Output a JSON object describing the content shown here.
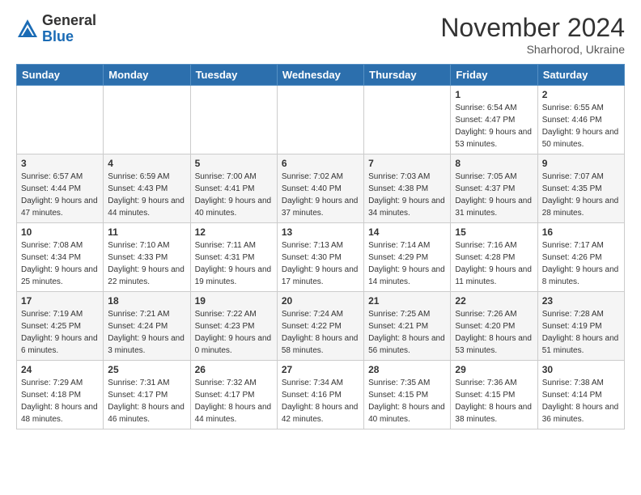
{
  "logo": {
    "general": "General",
    "blue": "Blue"
  },
  "header": {
    "month": "November 2024",
    "location": "Sharhorod, Ukraine"
  },
  "weekdays": [
    "Sunday",
    "Monday",
    "Tuesday",
    "Wednesday",
    "Thursday",
    "Friday",
    "Saturday"
  ],
  "weeks": [
    [
      null,
      null,
      null,
      null,
      null,
      {
        "day": "1",
        "sunrise": "Sunrise: 6:54 AM",
        "sunset": "Sunset: 4:47 PM",
        "daylight": "Daylight: 9 hours and 53 minutes."
      },
      {
        "day": "2",
        "sunrise": "Sunrise: 6:55 AM",
        "sunset": "Sunset: 4:46 PM",
        "daylight": "Daylight: 9 hours and 50 minutes."
      }
    ],
    [
      {
        "day": "3",
        "sunrise": "Sunrise: 6:57 AM",
        "sunset": "Sunset: 4:44 PM",
        "daylight": "Daylight: 9 hours and 47 minutes."
      },
      {
        "day": "4",
        "sunrise": "Sunrise: 6:59 AM",
        "sunset": "Sunset: 4:43 PM",
        "daylight": "Daylight: 9 hours and 44 minutes."
      },
      {
        "day": "5",
        "sunrise": "Sunrise: 7:00 AM",
        "sunset": "Sunset: 4:41 PM",
        "daylight": "Daylight: 9 hours and 40 minutes."
      },
      {
        "day": "6",
        "sunrise": "Sunrise: 7:02 AM",
        "sunset": "Sunset: 4:40 PM",
        "daylight": "Daylight: 9 hours and 37 minutes."
      },
      {
        "day": "7",
        "sunrise": "Sunrise: 7:03 AM",
        "sunset": "Sunset: 4:38 PM",
        "daylight": "Daylight: 9 hours and 34 minutes."
      },
      {
        "day": "8",
        "sunrise": "Sunrise: 7:05 AM",
        "sunset": "Sunset: 4:37 PM",
        "daylight": "Daylight: 9 hours and 31 minutes."
      },
      {
        "day": "9",
        "sunrise": "Sunrise: 7:07 AM",
        "sunset": "Sunset: 4:35 PM",
        "daylight": "Daylight: 9 hours and 28 minutes."
      }
    ],
    [
      {
        "day": "10",
        "sunrise": "Sunrise: 7:08 AM",
        "sunset": "Sunset: 4:34 PM",
        "daylight": "Daylight: 9 hours and 25 minutes."
      },
      {
        "day": "11",
        "sunrise": "Sunrise: 7:10 AM",
        "sunset": "Sunset: 4:33 PM",
        "daylight": "Daylight: 9 hours and 22 minutes."
      },
      {
        "day": "12",
        "sunrise": "Sunrise: 7:11 AM",
        "sunset": "Sunset: 4:31 PM",
        "daylight": "Daylight: 9 hours and 19 minutes."
      },
      {
        "day": "13",
        "sunrise": "Sunrise: 7:13 AM",
        "sunset": "Sunset: 4:30 PM",
        "daylight": "Daylight: 9 hours and 17 minutes."
      },
      {
        "day": "14",
        "sunrise": "Sunrise: 7:14 AM",
        "sunset": "Sunset: 4:29 PM",
        "daylight": "Daylight: 9 hours and 14 minutes."
      },
      {
        "day": "15",
        "sunrise": "Sunrise: 7:16 AM",
        "sunset": "Sunset: 4:28 PM",
        "daylight": "Daylight: 9 hours and 11 minutes."
      },
      {
        "day": "16",
        "sunrise": "Sunrise: 7:17 AM",
        "sunset": "Sunset: 4:26 PM",
        "daylight": "Daylight: 9 hours and 8 minutes."
      }
    ],
    [
      {
        "day": "17",
        "sunrise": "Sunrise: 7:19 AM",
        "sunset": "Sunset: 4:25 PM",
        "daylight": "Daylight: 9 hours and 6 minutes."
      },
      {
        "day": "18",
        "sunrise": "Sunrise: 7:21 AM",
        "sunset": "Sunset: 4:24 PM",
        "daylight": "Daylight: 9 hours and 3 minutes."
      },
      {
        "day": "19",
        "sunrise": "Sunrise: 7:22 AM",
        "sunset": "Sunset: 4:23 PM",
        "daylight": "Daylight: 9 hours and 0 minutes."
      },
      {
        "day": "20",
        "sunrise": "Sunrise: 7:24 AM",
        "sunset": "Sunset: 4:22 PM",
        "daylight": "Daylight: 8 hours and 58 minutes."
      },
      {
        "day": "21",
        "sunrise": "Sunrise: 7:25 AM",
        "sunset": "Sunset: 4:21 PM",
        "daylight": "Daylight: 8 hours and 56 minutes."
      },
      {
        "day": "22",
        "sunrise": "Sunrise: 7:26 AM",
        "sunset": "Sunset: 4:20 PM",
        "daylight": "Daylight: 8 hours and 53 minutes."
      },
      {
        "day": "23",
        "sunrise": "Sunrise: 7:28 AM",
        "sunset": "Sunset: 4:19 PM",
        "daylight": "Daylight: 8 hours and 51 minutes."
      }
    ],
    [
      {
        "day": "24",
        "sunrise": "Sunrise: 7:29 AM",
        "sunset": "Sunset: 4:18 PM",
        "daylight": "Daylight: 8 hours and 48 minutes."
      },
      {
        "day": "25",
        "sunrise": "Sunrise: 7:31 AM",
        "sunset": "Sunset: 4:17 PM",
        "daylight": "Daylight: 8 hours and 46 minutes."
      },
      {
        "day": "26",
        "sunrise": "Sunrise: 7:32 AM",
        "sunset": "Sunset: 4:17 PM",
        "daylight": "Daylight: 8 hours and 44 minutes."
      },
      {
        "day": "27",
        "sunrise": "Sunrise: 7:34 AM",
        "sunset": "Sunset: 4:16 PM",
        "daylight": "Daylight: 8 hours and 42 minutes."
      },
      {
        "day": "28",
        "sunrise": "Sunrise: 7:35 AM",
        "sunset": "Sunset: 4:15 PM",
        "daylight": "Daylight: 8 hours and 40 minutes."
      },
      {
        "day": "29",
        "sunrise": "Sunrise: 7:36 AM",
        "sunset": "Sunset: 4:15 PM",
        "daylight": "Daylight: 8 hours and 38 minutes."
      },
      {
        "day": "30",
        "sunrise": "Sunrise: 7:38 AM",
        "sunset": "Sunset: 4:14 PM",
        "daylight": "Daylight: 8 hours and 36 minutes."
      }
    ]
  ]
}
